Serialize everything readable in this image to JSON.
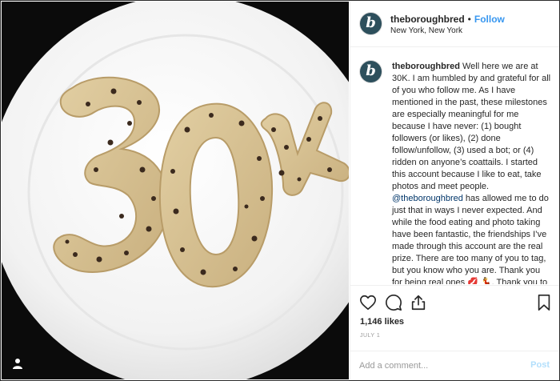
{
  "post": {
    "username": "theboroughbred",
    "avatar_letter": "b",
    "separator": "•",
    "follow_label": "Follow",
    "location": "New York, New York",
    "caption_username": "theboroughbred",
    "caption_part1": "Well here we are at 30K. I am humbled by and grateful for all of you who follow me. As I have mentioned in the past, these milestones are especially meaningful for me because I have never: (1) bought followers (or likes), (2) done follow/unfollow, (3) used a bot; or (4) ridden on anyone’s coattails. I started this account because I like to eat, take photos and meet people.",
    "caption_mention": "@theboroughbred",
    "caption_part2": "has allowed me to do just that in ways I never expected. And while the food eating and photo taking have been fantastic, the friendships I’ve made through this account are the real prize. There are too many of you to tag, but you know who you are. Thank you for being real ones 💋 💃. Thank you to my",
    "likes_text": "1,146 likes",
    "date_text": "July 1",
    "comment_placeholder": "Add a comment...",
    "post_label": "Post"
  },
  "icons": {
    "like": "heart-icon",
    "comment": "comment-bubble-icon",
    "share": "share-icon",
    "save": "bookmark-icon",
    "tag": "user-tag-icon"
  },
  "colors": {
    "accent": "#3897f0",
    "post_disabled": "#b2dffc",
    "mention": "#003569"
  }
}
